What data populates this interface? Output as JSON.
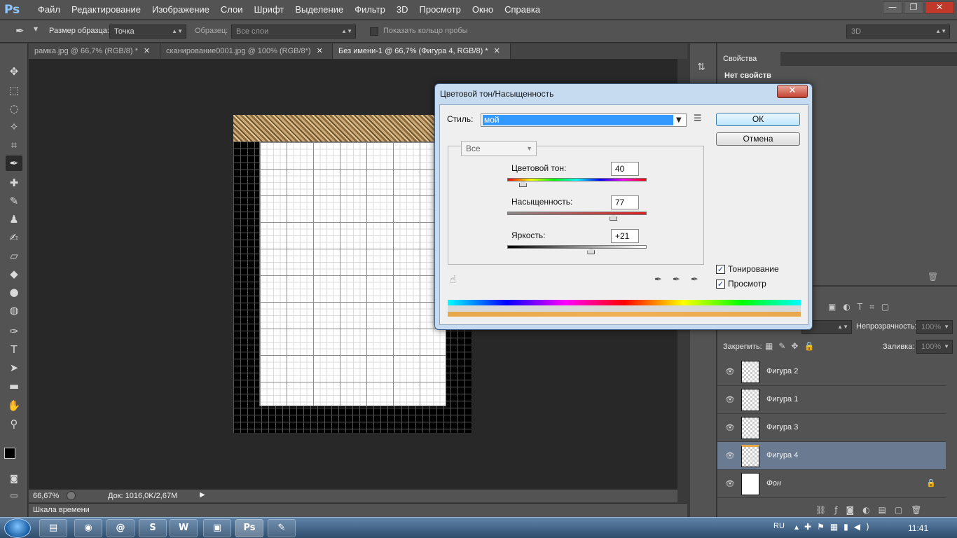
{
  "app": {
    "logo": "Ps"
  },
  "menu": [
    "Файл",
    "Редактирование",
    "Изображение",
    "Слои",
    "Шрифт",
    "Выделение",
    "Фильтр",
    "3D",
    "Просмотр",
    "Окно",
    "Справка"
  ],
  "window_controls": {
    "minimize": "—",
    "restore": "❐",
    "close": "✕"
  },
  "options": {
    "sample_size_label": "Размер образца:",
    "sample_size_value": "Точка",
    "sample_label": "Образец:",
    "sample_value": "Все слои",
    "show_ring_label": "Показать кольцо пробы",
    "workspace": "3D"
  },
  "tabs": [
    {
      "label": "рамка.jpg @ 66,7% (RGB/8) *",
      "close": "✕"
    },
    {
      "label": "сканирование0001.jpg @ 100% (RGB/8*)",
      "close": "✕"
    },
    {
      "label": "Без имени-1 @ 66,7% (Фигура 4, RGB/8) *",
      "close": "✕"
    }
  ],
  "status": {
    "zoom": "66,67%",
    "doc": "Док: 1016,0K/2,67M"
  },
  "timeline": {
    "label": "Шкала времени"
  },
  "properties": {
    "tab": "Свойства",
    "empty": "Нет свойств"
  },
  "layers_panel": {
    "opacity_label": "Непрозрачность:",
    "opacity_value": "100%",
    "lock_label": "Закрепить:",
    "fill_label": "Заливка:",
    "fill_value": "100%",
    "layers": [
      {
        "name": "Фигура 2",
        "selected": false
      },
      {
        "name": "Фигура 1",
        "selected": false
      },
      {
        "name": "Фигура 3",
        "selected": false
      },
      {
        "name": "Фигура 4",
        "selected": true
      },
      {
        "name": "Фон",
        "selected": false
      }
    ]
  },
  "dialog": {
    "title": "Цветовой тон/Насыщенность",
    "close": "✕",
    "style_label": "Стиль:",
    "style_value": "мой",
    "ok": "ОК",
    "cancel": "Отмена",
    "channel": "Все",
    "hue_label": "Цветовой тон:",
    "hue_value": "40",
    "saturation_label": "Насыщенность:",
    "saturation_value": "77",
    "lightness_label": "Яркость:",
    "lightness_value": "+21",
    "colorize_label": "Тонирование",
    "colorize_checked": true,
    "preview_label": "Просмотр",
    "preview_checked": true,
    "hue_slider_fraction": 0.11,
    "saturation_slider_fraction": 0.76,
    "lightness_slider_fraction": 0.6
  },
  "taskbar": {
    "language": "RU",
    "clock": "11:41",
    "apps": [
      "folder-icon",
      "chrome-icon",
      "network-icon",
      "skype-icon",
      "word-icon",
      "presentation-icon",
      "photoshop-icon",
      "paint-icon"
    ],
    "app_glyphs": [
      "▤",
      "◉",
      "@",
      "S",
      "W",
      "▣",
      "Ps",
      "✎"
    ]
  },
  "colors": {
    "accent": "#3399ff",
    "selected_layer": "#6a7a90",
    "panel": "#535353"
  }
}
